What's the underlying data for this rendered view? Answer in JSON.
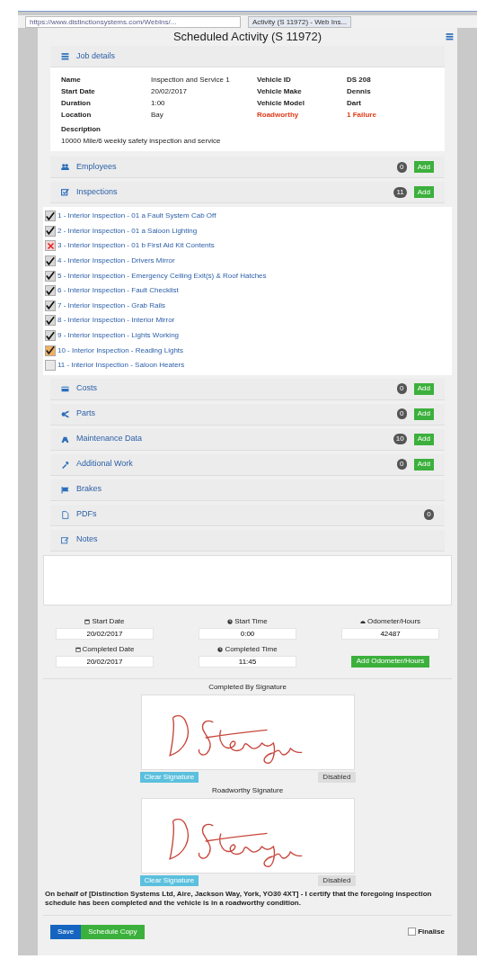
{
  "browser": {
    "address": "https://www.distinctionsystems.com/WebIns/...",
    "tab": "Activity (S 11972) - Web Ins..."
  },
  "title": "Scheduled Activity (S 11972)",
  "job_details": {
    "heading": "Job details",
    "fields": [
      {
        "label": "Name",
        "value": "Inspection and Service 1",
        "label2": "Vehicle ID",
        "value2": "DS 208",
        "alert": false
      },
      {
        "label": "Start Date",
        "value": "20/02/2017",
        "label2": "Vehicle Make",
        "value2": "Dennis",
        "alert": false
      },
      {
        "label": "Duration",
        "value": "1:00",
        "label2": "Vehicle Model",
        "value2": "Dart",
        "alert": false
      },
      {
        "label": "Location",
        "value": "Bay",
        "label2": "Roadworthy",
        "value2": "1 Failure",
        "alert": true
      }
    ],
    "description_label": "Description",
    "description": "10000 Mile/6 weekly safety inspection and service"
  },
  "sections": [
    {
      "kind": "employees",
      "heading": "Employees",
      "count": "0",
      "add": "Add"
    },
    {
      "kind": "inspections",
      "heading": "Inspections",
      "count": "11",
      "add": "Add",
      "items": [
        {
          "kind": "pass",
          "checked": true,
          "text": "1 - Interior Inspection - 01 a Fault System Cab Off"
        },
        {
          "kind": "pass",
          "checked": true,
          "text": "2 - Interior Inspection - 01 a Saloon Lighting"
        },
        {
          "kind": "fail",
          "checked": true,
          "text": "3 - Interior Inspection - 01 b First Aid Kit Contents"
        },
        {
          "kind": "pass",
          "checked": true,
          "text": "4 - Interior Inspection - Drivers Mirror"
        },
        {
          "kind": "pass",
          "checked": true,
          "text": "5 - Interior Inspection - Emergency Ceiling Exit(s) & Roof Hatches"
        },
        {
          "kind": "pass",
          "checked": true,
          "text": "6 - Interior Inspection - Fault Checklist"
        },
        {
          "kind": "pass",
          "checked": true,
          "text": "7 - Interior Inspection - Grab Rails"
        },
        {
          "kind": "pass",
          "checked": true,
          "text": "8 - Interior Inspection - Interior Mirror"
        },
        {
          "kind": "pass",
          "checked": true,
          "text": "9 - Interior Inspection - Lights Working"
        },
        {
          "kind": "advisory",
          "checked": true,
          "text": "10 - Interior Inspection - Reading Lights"
        },
        {
          "checked": false,
          "text": "11 - Interior Inspection - Saloon Heaters"
        }
      ]
    },
    {
      "kind": "costs",
      "heading": "Costs",
      "count": "0",
      "add": "Add"
    },
    {
      "kind": "parts",
      "heading": "Parts",
      "count": "0",
      "add": "Add"
    },
    {
      "kind": "maintenance",
      "heading": "Maintenance Data",
      "count": "10",
      "add": "Add"
    },
    {
      "kind": "work",
      "heading": "Additional Work",
      "count": "0",
      "add": "Add"
    },
    {
      "kind": "brakes",
      "heading": "Brakes"
    },
    {
      "kind": "pdfs",
      "heading": "PDFs",
      "count": "0"
    },
    {
      "kind": "notes",
      "heading": "Notes"
    }
  ],
  "times": [
    {
      "label": "Start Date",
      "value": "20/02/2017"
    },
    {
      "label": "Start Time",
      "value": "0:00"
    },
    {
      "label": "Odometer/Hours",
      "value": "42487"
    },
    {
      "label": "Completed Date",
      "value": "20/02/2017"
    },
    {
      "label": "Completed Time",
      "value": "11:45"
    }
  ],
  "odometer_button": "Add Odometer/Hours",
  "signatures": [
    {
      "label": "Completed By Signature",
      "clear": "Clear Signature",
      "status": "Disabled"
    },
    {
      "label": "Roadworthy Signature",
      "clear": "Clear Signature",
      "status": "Disabled"
    }
  ],
  "certification": "On behalf of [Distinction Systems Ltd, Aire, Jackson Way, York, YO30 4XT] - I certify that the foregoing inspection schedule has been completed and the vehicle is in a roadworthy condition.",
  "buttons": [
    "Save",
    "Schedule Copy"
  ],
  "finalise": {
    "label": "Finalise",
    "checked": false
  }
}
